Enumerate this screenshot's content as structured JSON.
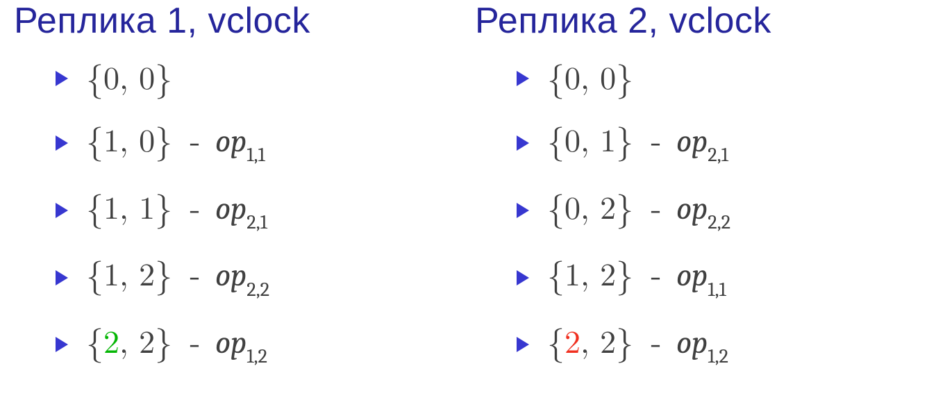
{
  "columns": [
    {
      "heading": "Реплика 1, vclock",
      "items": [
        {
          "v0": "0",
          "v1": "0",
          "v0_color": null,
          "v1_color": null,
          "op_i": null,
          "op_j": null
        },
        {
          "v0": "1",
          "v1": "0",
          "v0_color": null,
          "v1_color": null,
          "op_i": "1",
          "op_j": "1"
        },
        {
          "v0": "1",
          "v1": "1",
          "v0_color": null,
          "v1_color": null,
          "op_i": "2",
          "op_j": "1"
        },
        {
          "v0": "1",
          "v1": "2",
          "v0_color": null,
          "v1_color": null,
          "op_i": "2",
          "op_j": "2"
        },
        {
          "v0": "2",
          "v1": "2",
          "v0_color": "green",
          "v1_color": null,
          "op_i": "1",
          "op_j": "2"
        }
      ]
    },
    {
      "heading": "Реплика 2, vclock",
      "items": [
        {
          "v0": "0",
          "v1": "0",
          "v0_color": null,
          "v1_color": null,
          "op_i": null,
          "op_j": null
        },
        {
          "v0": "0",
          "v1": "1",
          "v0_color": null,
          "v1_color": null,
          "op_i": "2",
          "op_j": "1"
        },
        {
          "v0": "0",
          "v1": "2",
          "v0_color": null,
          "v1_color": null,
          "op_i": "2",
          "op_j": "2"
        },
        {
          "v0": "1",
          "v1": "2",
          "v0_color": null,
          "v1_color": null,
          "op_i": "1",
          "op_j": "1"
        },
        {
          "v0": "2",
          "v1": "2",
          "v0_color": "red",
          "v1_color": null,
          "op_i": "1",
          "op_j": "2"
        }
      ]
    }
  ],
  "glyphs": {
    "lbrace": "{",
    "rbrace": "}",
    "comma": ", ",
    "dash": " - ",
    "op_label": "op"
  }
}
